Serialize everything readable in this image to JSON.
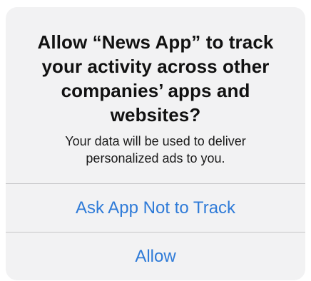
{
  "alert": {
    "title": "Allow “News App” to track your activity across other companies’ apps and websites?",
    "message": "Your data will be used to deliver personalized ads to you.",
    "buttons": {
      "ask_not_to_track": "Ask App Not to Track",
      "allow": "Allow"
    },
    "colors": {
      "background": "#f2f2f3",
      "button_text": "#2f7bd8",
      "divider": "#c6c6c8"
    }
  }
}
